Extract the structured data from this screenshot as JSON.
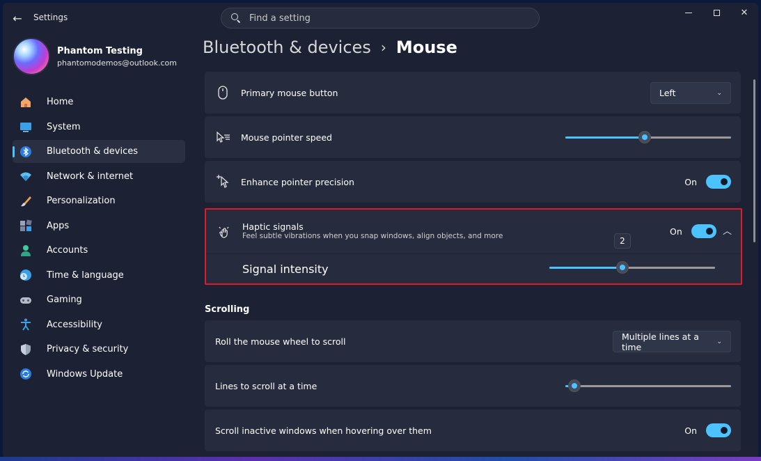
{
  "window": {
    "title": "Settings"
  },
  "search": {
    "placeholder": "Find a setting"
  },
  "profile": {
    "name": "Phantom Testing",
    "email": "phantomodemos@outlook.com"
  },
  "nav": {
    "items": [
      {
        "label": "Home",
        "icon": "home-icon"
      },
      {
        "label": "System",
        "icon": "system-icon"
      },
      {
        "label": "Bluetooth & devices",
        "icon": "bluetooth-icon",
        "active": true
      },
      {
        "label": "Network & internet",
        "icon": "wifi-icon"
      },
      {
        "label": "Personalization",
        "icon": "brush-icon"
      },
      {
        "label": "Apps",
        "icon": "apps-icon"
      },
      {
        "label": "Accounts",
        "icon": "accounts-icon"
      },
      {
        "label": "Time & language",
        "icon": "time-language-icon"
      },
      {
        "label": "Gaming",
        "icon": "gaming-icon"
      },
      {
        "label": "Accessibility",
        "icon": "accessibility-icon"
      },
      {
        "label": "Privacy & security",
        "icon": "shield-icon"
      },
      {
        "label": "Windows Update",
        "icon": "windows-update-icon"
      }
    ]
  },
  "breadcrumb": {
    "parent": "Bluetooth & devices",
    "separator": "›",
    "current": "Mouse"
  },
  "settings": {
    "primary_button": {
      "label": "Primary mouse button",
      "value": "Left"
    },
    "pointer_speed": {
      "label": "Mouse pointer speed",
      "level": 0.48
    },
    "precision": {
      "label": "Enhance pointer precision",
      "state": "On"
    },
    "haptic": {
      "label": "Haptic signals",
      "description": "Feel subtle vibrations when you snap windows, align objects, and more",
      "state": "On",
      "intensity_label": "Signal intensity",
      "intensity_value": "2",
      "intensity_level": 0.44
    }
  },
  "scrolling": {
    "section_title": "Scrolling",
    "wheel": {
      "label": "Roll the mouse wheel to scroll",
      "value": "Multiple lines at a time"
    },
    "lines": {
      "label": "Lines to scroll at a time",
      "level": 0.05
    },
    "inactive": {
      "label": "Scroll inactive windows when hovering over them",
      "state": "On"
    }
  },
  "colors": {
    "accent": "#4cc2ff",
    "highlight_border": "#e01c2a",
    "card": "#262c3d",
    "background": "#1c2233"
  }
}
